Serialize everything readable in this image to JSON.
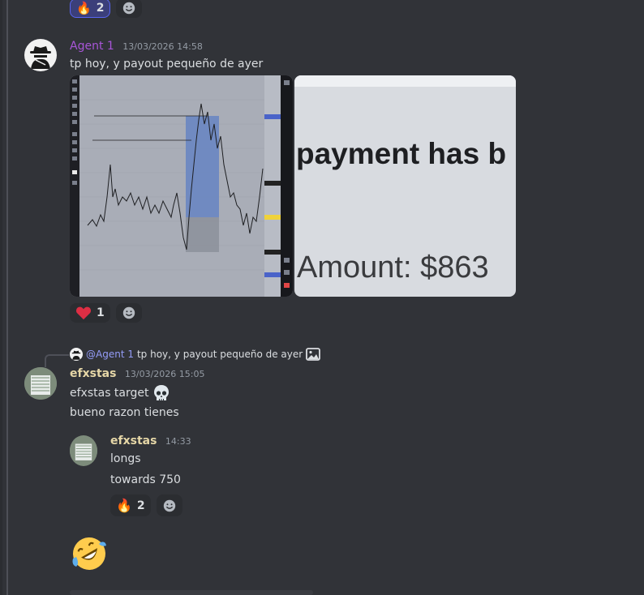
{
  "top_reactions": {
    "fire_count": "2"
  },
  "message1": {
    "author": "Agent 1",
    "timestamp": "13/03/2026 14:58",
    "text": "tp hoy, y payout pequeño de ayer",
    "payment_image": {
      "line1": "payment has b",
      "line2": "Amount: $863"
    },
    "reactions": {
      "heart_count": "1"
    }
  },
  "reply": {
    "mention": "@Agent 1",
    "text": "tp hoy, y payout pequeño de ayer"
  },
  "message2": {
    "author": "efxstas",
    "timestamp": "13/03/2026 15:05",
    "lines": [
      "efxstas target",
      "bueno razon tienes"
    ]
  },
  "message3": {
    "author": "efxstas",
    "timestamp": "14:33",
    "lines": [
      "longs",
      "towards 750"
    ],
    "reactions": {
      "fire_count": "2"
    }
  },
  "colors": {
    "background": "#313338",
    "accent": "#5865f2",
    "agent_name": "#a855d8",
    "efx_name": "#e6d7a7"
  },
  "icons": [
    "fire-icon",
    "smiley-add-icon",
    "heart-icon",
    "skull-icon",
    "laughing-emoji-icon",
    "image-icon"
  ]
}
